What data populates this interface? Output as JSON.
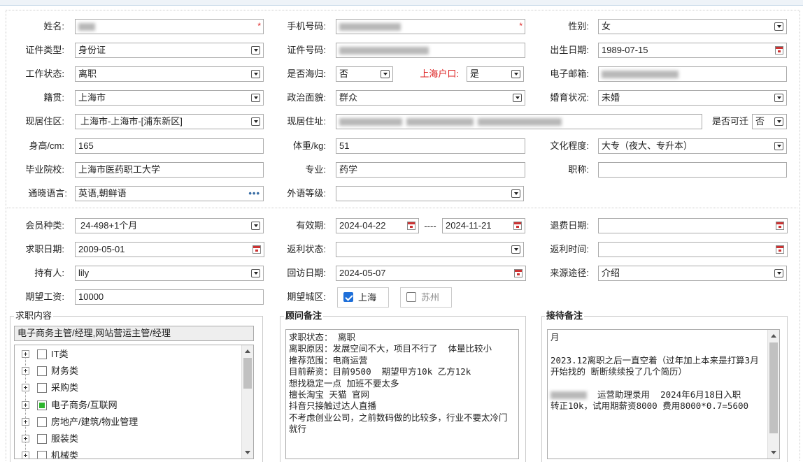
{
  "labels": {
    "name": "姓名:",
    "phone": "手机号码:",
    "gender": "性别:",
    "id_type": "证件类型:",
    "id_no": "证件号码:",
    "birth": "出生日期:",
    "work_status": "工作状态:",
    "overseas": "是否海归:",
    "shanghai_hukou": "上海户口:",
    "email": "电子邮箱:",
    "native": "籍贯:",
    "political": "政治面貌:",
    "marital": "婚育状况:",
    "residence": "现居住区:",
    "address": "现居住址:",
    "relocate": "是否可迁",
    "height": "身高/cm:",
    "weight": "体重/kg:",
    "education": "文化程度:",
    "school": "毕业院校:",
    "major": "专业:",
    "title": "职称:",
    "languages": "通晓语言:",
    "foreign_level": "外语等级:",
    "member_type": "会员种类:",
    "valid_period": "有效期:",
    "refund_date": "退费日期:",
    "job_date": "求职日期:",
    "rebate_status": "返利状态:",
    "rebate_time": "返利时间:",
    "holder": "持有人:",
    "visit_date": "回访日期:",
    "source": "来源途径:",
    "salary": "期望工资:",
    "city": "期望城区:"
  },
  "values": {
    "gender": "女",
    "id_type": "身份证",
    "birth": "1989-07-15",
    "work_status": "离职",
    "overseas": "否",
    "shanghai_hukou": "是",
    "native": "上海市",
    "political": "群众",
    "marital": "未婚",
    "residence": "上海市-上海市-[浦东新区]",
    "relocate": "否",
    "height": "165",
    "weight": "51",
    "education": "大专（夜大、专升本）",
    "school": "上海市医药职工大学",
    "major": "药学",
    "title": "",
    "languages": "英语,朝鲜语",
    "foreign_level": "",
    "member_type": "24-498+1个月",
    "valid_from": "2024-04-22",
    "valid_sep": "----",
    "valid_to": "2024-11-21",
    "refund_date": "",
    "job_date": "2009-05-01",
    "rebate_status": "",
    "rebate_time": "",
    "holder": "lily",
    "visit_date": "2024-05-07",
    "source": "介绍",
    "salary": "10000"
  },
  "required_mark": "*",
  "more_icon": "•••",
  "cities": [
    {
      "label": "上海",
      "checked": true
    },
    {
      "label": "苏州",
      "checked": false
    }
  ],
  "job_panel": {
    "title": "求职内容",
    "selected": "电子商务主管/经理,网站营运主管/经理",
    "categories": [
      {
        "label": "IT类",
        "checked": false
      },
      {
        "label": "财务类",
        "checked": false
      },
      {
        "label": "采购类",
        "checked": false
      },
      {
        "label": "电子商务/互联网",
        "checked": true
      },
      {
        "label": "房地产/建筑/物业管理",
        "checked": false
      },
      {
        "label": "服装类",
        "checked": false
      },
      {
        "label": "机械类",
        "checked": false
      }
    ]
  },
  "advisor_panel": {
    "title": "顾问备注",
    "text": "求职状态： 离职\n离职原因：发展空间不大，项目不行了  体量比较小\n推荐范围：电商运营\n目前薪资：目前9500  期望甲方10k 乙方12k\n想找稳定一点 加班不要太多\n擅长淘宝 天猫 官网\n抖音只接触过达人直播\n不考虑创业公司，之前数码做的比较多，行业不要太冷门就行"
  },
  "reception_panel": {
    "title": "接待备注",
    "line1": "月",
    "line2": "2023.12离职之后一直空着（过年加上本来是打算3月开始找的 断断续续投了几个简历）",
    "line3": "  运营助理录用  2024年6月18日入职",
    "line4": "转正10k，试用期薪资8000 费用8000*0.7=5600"
  }
}
